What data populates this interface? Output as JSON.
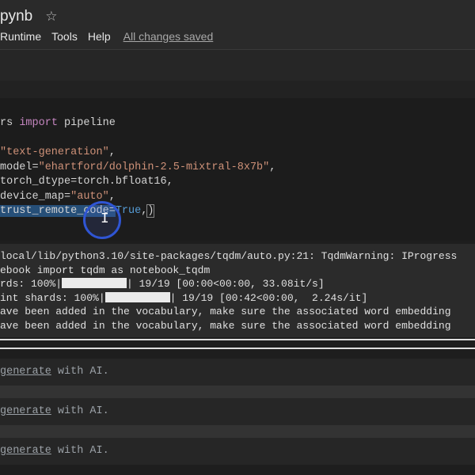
{
  "header": {
    "title": "pynb",
    "menu": [
      "Runtime",
      "Tools",
      "Help"
    ],
    "saved_status": "All changes saved"
  },
  "code": {
    "line1": {
      "prefix": "rs ",
      "keyword": "import",
      "rest": " pipeline"
    },
    "line2": {
      "text": "\"text-generation\"",
      "comma": ","
    },
    "line3": {
      "arg": "model=",
      "str": "\"ehartford/dolphin-2.5-mixtral-8x7b\"",
      "comma": ","
    },
    "line4": {
      "text": "torch_dtype=torch.bfloat16,"
    },
    "line5": {
      "arg": "device_map=",
      "str": "\"auto\"",
      "comma": ","
    },
    "line6": {
      "selected": "trust_remote_code=",
      "value": "True",
      "comma": ",",
      "paren": ")"
    }
  },
  "output": {
    "line1": "local/lib/python3.10/site-packages/tqdm/auto.py:21: TqdmWarning: IProgress",
    "line2": "ebook import tqdm as notebook_tqdm",
    "line3_a": "rds: 100%|",
    "line3_b": "| 19/19 [00:00<00:00, 33.08it/s]",
    "line4_a": "int shards: 100%|",
    "line4_b": "| 19/19 [00:42<00:00,  2.24s/it]",
    "line5": "ave been added in the vocabulary, make sure the associated word embedding",
    "line6": "ave been added in the vocabulary, make sure the associated word embedding"
  },
  "ai_cells": [
    {
      "link": "generate",
      "rest": " with AI."
    },
    {
      "link": "generate",
      "rest": " with AI."
    },
    {
      "link": "generate",
      "rest": " with AI."
    }
  ]
}
